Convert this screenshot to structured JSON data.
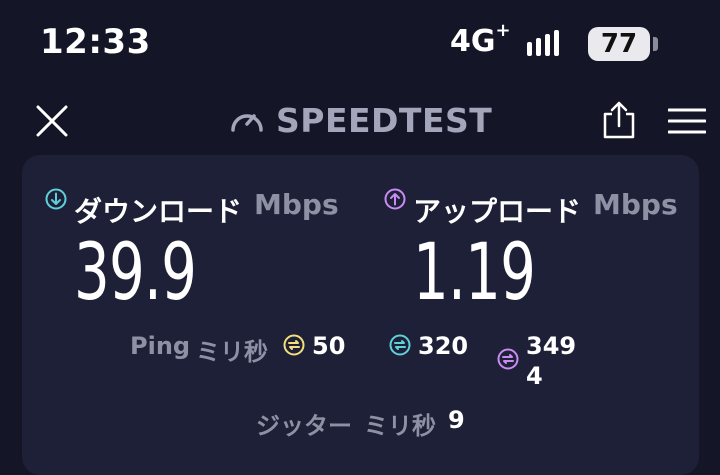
{
  "status": {
    "time": "12:33",
    "network": "4G",
    "network_sup": "+",
    "battery": "77"
  },
  "header": {
    "title": "SPEEDTEST"
  },
  "download": {
    "label": "ダウンロード",
    "unit": "Mbps",
    "value": "39.9"
  },
  "upload": {
    "label": "アップロード",
    "unit": "Mbps",
    "value": "1.19"
  },
  "ping": {
    "label": "Ping",
    "unit": "ミリ秒",
    "idle": "50",
    "download": "320",
    "upload_line1": "349",
    "upload_line2": "4"
  },
  "jitter": {
    "label": "ジッター",
    "unit": "ミリ秒",
    "value": "9"
  },
  "colors": {
    "download": "#5ed2d8",
    "upload": "#c98cf2",
    "idle": "#f4df7c"
  }
}
